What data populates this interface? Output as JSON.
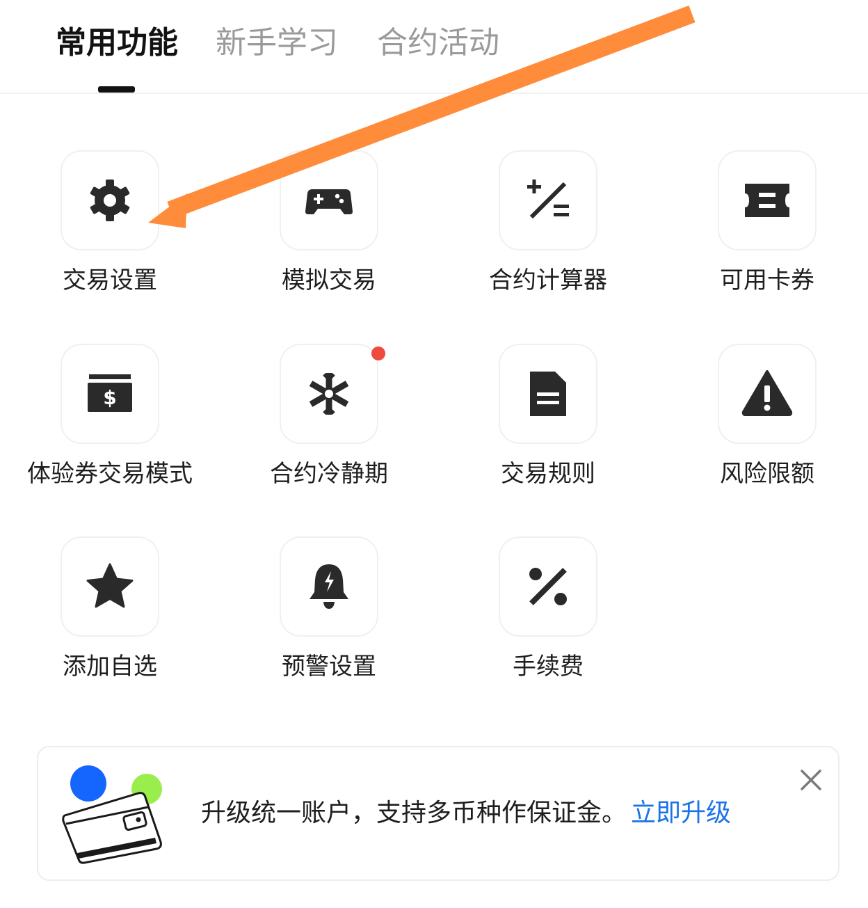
{
  "tabs": [
    {
      "label": "常用功能",
      "active": true
    },
    {
      "label": "新手学习",
      "active": false
    },
    {
      "label": "合约活动",
      "active": false
    }
  ],
  "grid": {
    "items": [
      {
        "label": "交易设置",
        "icon": "gear-icon"
      },
      {
        "label": "模拟交易",
        "icon": "gamepad-icon"
      },
      {
        "label": "合约计算器",
        "icon": "calculator-icon"
      },
      {
        "label": "可用卡券",
        "icon": "ticket-icon"
      },
      {
        "label": "体验券交易模式",
        "icon": "cash-icon"
      },
      {
        "label": "合约冷静期",
        "icon": "snowflake-icon",
        "badge": "red-dot"
      },
      {
        "label": "交易规则",
        "icon": "document-icon"
      },
      {
        "label": "风险限额",
        "icon": "warning-icon"
      },
      {
        "label": "添加自选",
        "icon": "star-icon"
      },
      {
        "label": "预警设置",
        "icon": "bell-alert-icon"
      },
      {
        "label": "手续费",
        "icon": "percent-icon"
      }
    ]
  },
  "banner": {
    "text": "升级统一账户，支持多币种作保证金。",
    "link": "立即升级",
    "close_icon": "close-icon",
    "illustration": "wallet-illustration"
  },
  "colors": {
    "accent_link": "#1a73e8",
    "annotation_arrow": "#ff8c3a",
    "notification_dot": "#f04a3f",
    "icon": "#2a2a2a"
  }
}
